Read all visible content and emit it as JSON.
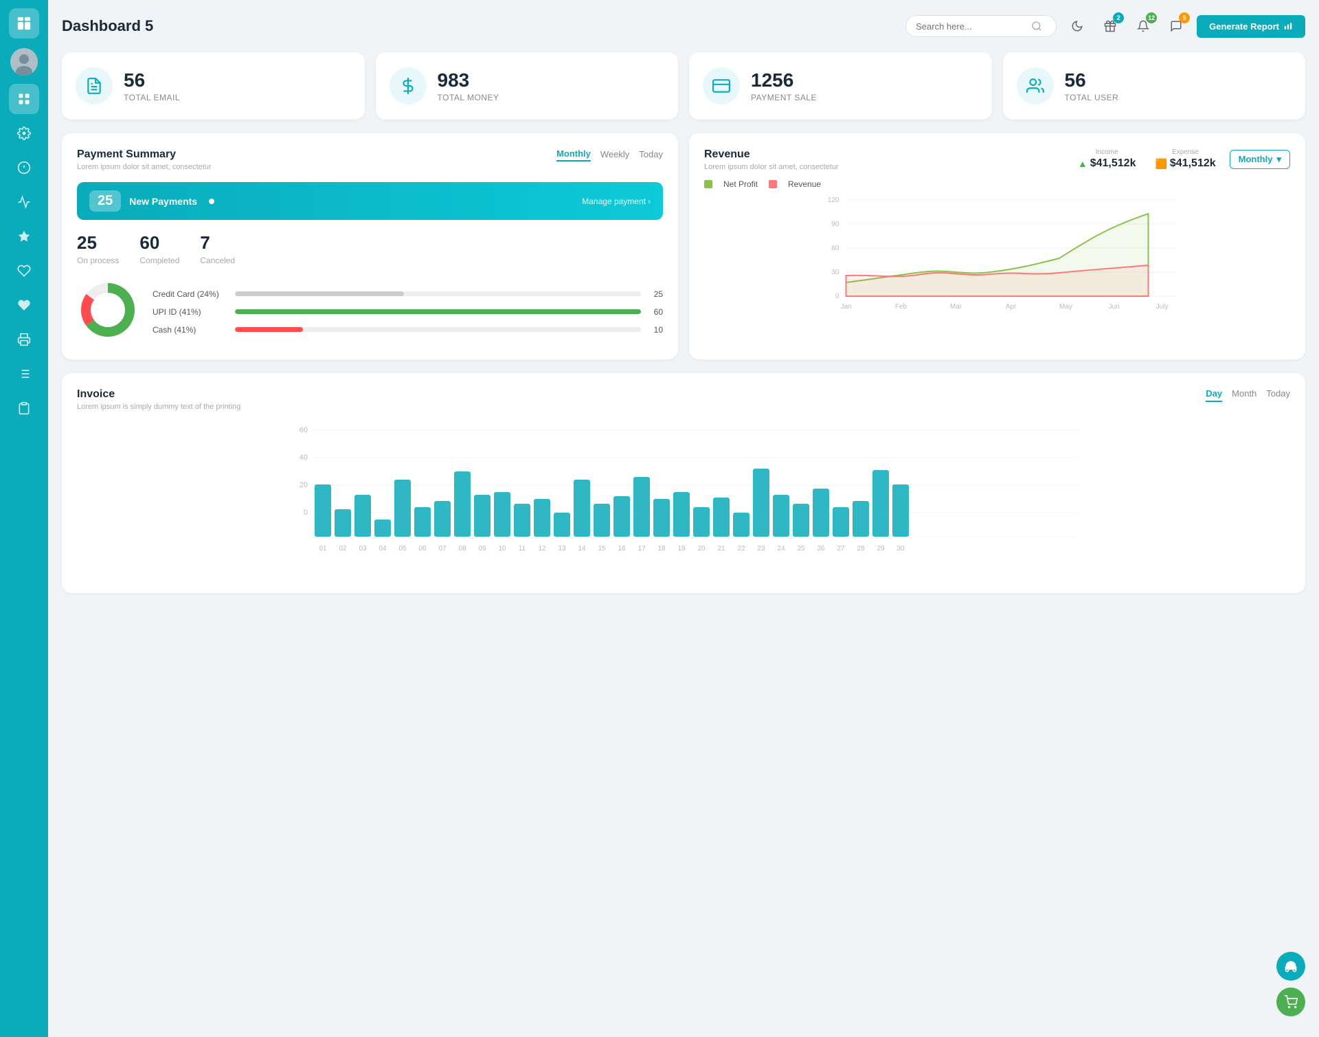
{
  "app": {
    "title": "Dashboard 5",
    "generate_btn": "Generate Report"
  },
  "header": {
    "search_placeholder": "Search here...",
    "badge_gift": "2",
    "badge_bell": "12",
    "badge_chat": "5"
  },
  "stats": [
    {
      "id": "total-email",
      "number": "56",
      "label": "TOTAL EMAIL",
      "icon": "📋"
    },
    {
      "id": "total-money",
      "number": "983",
      "label": "TOTAL MONEY",
      "icon": "💲"
    },
    {
      "id": "payment-sale",
      "number": "1256",
      "label": "PAYMENT SALE",
      "icon": "💳"
    },
    {
      "id": "total-user",
      "number": "56",
      "label": "TOTAL USER",
      "icon": "👥"
    }
  ],
  "payment_summary": {
    "title": "Payment Summary",
    "subtitle": "Lorem ipsum dolor sit amet, consectetur",
    "tabs": [
      "Monthly",
      "Weekly",
      "Today"
    ],
    "active_tab": "Monthly",
    "new_payments": {
      "count": "25",
      "label": "New Payments",
      "manage_link": "Manage payment"
    },
    "stats": [
      {
        "num": "25",
        "label": "On process"
      },
      {
        "num": "60",
        "label": "Completed"
      },
      {
        "num": "7",
        "label": "Canceled"
      }
    ],
    "progress_items": [
      {
        "label": "Credit Card (24%)",
        "value": 25,
        "max": 60,
        "color": "#ccc",
        "display": "25"
      },
      {
        "label": "UPI ID (41%)",
        "value": 60,
        "max": 60,
        "color": "#4caf50",
        "display": "60"
      },
      {
        "label": "Cash (41%)",
        "value": 10,
        "max": 60,
        "color": "#ff4d4f",
        "display": "10"
      }
    ],
    "donut": {
      "green_pct": 65,
      "red_pct": 20,
      "gray_pct": 15
    }
  },
  "revenue": {
    "title": "Revenue",
    "subtitle": "Lorem ipsum dolor sit amet, consectetur",
    "dropdown_label": "Monthly",
    "income_label": "Income",
    "income_val": "$41,512k",
    "expense_label": "Expense",
    "expense_val": "$41,512k",
    "legend": [
      {
        "color": "#8BC34A",
        "label": "Net Profit"
      },
      {
        "color": "#ff7875",
        "label": "Revenue"
      }
    ],
    "x_labels": [
      "Jan",
      "Feb",
      "Mar",
      "Apr",
      "May",
      "Jun",
      "July"
    ],
    "y_labels": [
      "120",
      "90",
      "60",
      "30",
      "0"
    ]
  },
  "invoice": {
    "title": "Invoice",
    "subtitle": "Lorem ipsum is simply dummy text of the printing",
    "tabs": [
      "Day",
      "Month",
      "Today"
    ],
    "active_tab": "Day",
    "y_labels": [
      "60",
      "40",
      "20",
      "0"
    ],
    "x_labels": [
      "01",
      "02",
      "03",
      "04",
      "05",
      "06",
      "07",
      "08",
      "09",
      "10",
      "11",
      "12",
      "13",
      "14",
      "15",
      "16",
      "17",
      "18",
      "19",
      "20",
      "21",
      "22",
      "23",
      "24",
      "25",
      "26",
      "27",
      "28",
      "29",
      "30"
    ],
    "bar_data": [
      35,
      12,
      28,
      5,
      38,
      15,
      20,
      44,
      28,
      30,
      18,
      22,
      8,
      38,
      18,
      27,
      40,
      22,
      30,
      14,
      25,
      10,
      47,
      28,
      18,
      32,
      14,
      20,
      46,
      35
    ]
  },
  "sidebar": {
    "items": [
      {
        "icon": "wallet",
        "active": false
      },
      {
        "icon": "grid",
        "active": true
      },
      {
        "icon": "gear",
        "active": false
      },
      {
        "icon": "info",
        "active": false
      },
      {
        "icon": "chart",
        "active": false
      },
      {
        "icon": "star",
        "active": false
      },
      {
        "icon": "heart-outline",
        "active": false
      },
      {
        "icon": "heart-filled",
        "active": false
      },
      {
        "icon": "printer",
        "active": false
      },
      {
        "icon": "list",
        "active": false
      },
      {
        "icon": "clipboard",
        "active": false
      }
    ]
  },
  "floating": {
    "btn1": "headset",
    "btn2": "cart"
  }
}
